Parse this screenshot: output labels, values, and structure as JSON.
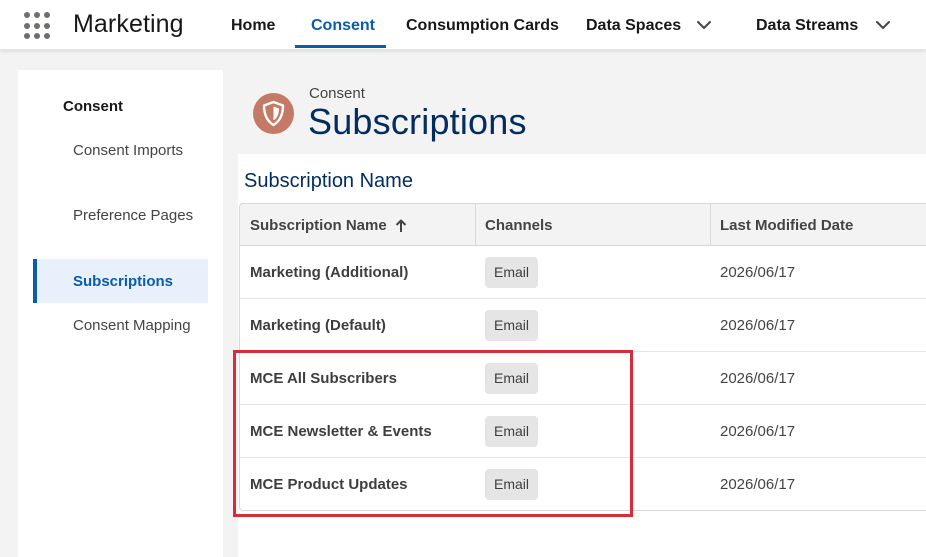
{
  "app": {
    "name": "Marketing"
  },
  "nav": {
    "items": [
      {
        "label": "Home",
        "active": false
      },
      {
        "label": "Consent",
        "active": true
      },
      {
        "label": "Consumption Cards",
        "active": false
      },
      {
        "label": "Data Spaces",
        "active": false,
        "has_dropdown": true
      },
      {
        "label": "Data Streams",
        "active": false,
        "has_dropdown": true
      }
    ]
  },
  "sidebar": {
    "title": "Consent",
    "items": [
      {
        "label": "Consent Imports",
        "active": false
      },
      {
        "label": "Preference Pages",
        "active": false
      },
      {
        "label": "Subscriptions",
        "active": true
      },
      {
        "label": "Consent Mapping",
        "active": false
      }
    ]
  },
  "header": {
    "eyebrow": "Consent",
    "title": "Subscriptions",
    "icon": "shield-icon",
    "icon_color": "#c47a66"
  },
  "list": {
    "title": "Subscription Name",
    "columns": [
      "Subscription Name",
      "Channels",
      "Last Modified Date"
    ],
    "sort_icon": "arrow-up-icon",
    "rows": [
      {
        "name": "Marketing (Additional)",
        "channel": "Email",
        "date": "2026/06/17"
      },
      {
        "name": "Marketing (Default)",
        "channel": "Email",
        "date": "2026/06/17"
      },
      {
        "name": "MCE All Subscribers",
        "channel": "Email",
        "date": "2026/06/17"
      },
      {
        "name": "MCE Newsletter & Events",
        "channel": "Email",
        "date": "2026/06/17"
      },
      {
        "name": "MCE Product Updates",
        "channel": "Email",
        "date": "2026/06/17"
      }
    ]
  },
  "colors": {
    "accent": "#0b5cab",
    "title": "#032d60",
    "highlight": "#d62d3b"
  }
}
